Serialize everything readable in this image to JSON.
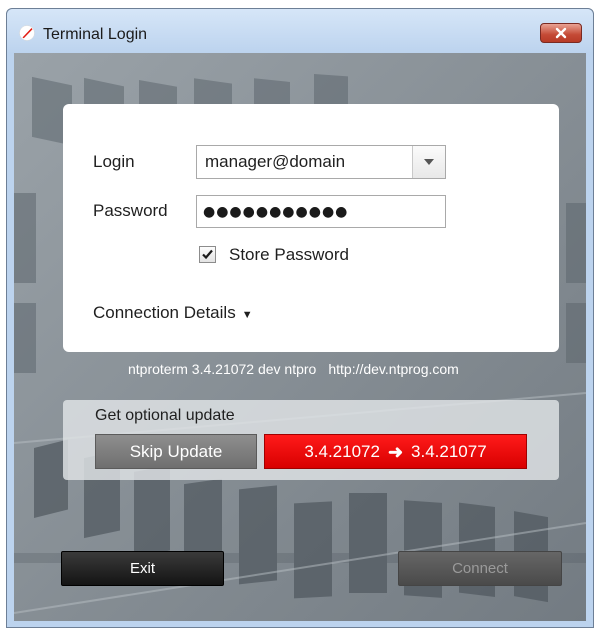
{
  "window": {
    "title": "Terminal Login"
  },
  "form": {
    "login_label": "Login",
    "login_value": "manager@domain",
    "password_label": "Password",
    "password_value": "●●●●●●●●●●●",
    "store_password_label": "Store Password",
    "store_password_checked": true,
    "connection_details_label": "Connection Details",
    "connection_details_caret": "▼"
  },
  "version": {
    "text": "ntproterm 3.4.21072 dev ntpro",
    "url": "http://dev.ntprog.com"
  },
  "update": {
    "title": "Get optional update",
    "skip_label": "Skip Update",
    "from_version": "3.4.21072",
    "to_version": "3.4.21077",
    "arrow": "➜"
  },
  "buttons": {
    "exit_label": "Exit",
    "connect_label": "Connect"
  },
  "colors": {
    "update_accent": "#e00000",
    "close_button": "#c44a35"
  }
}
